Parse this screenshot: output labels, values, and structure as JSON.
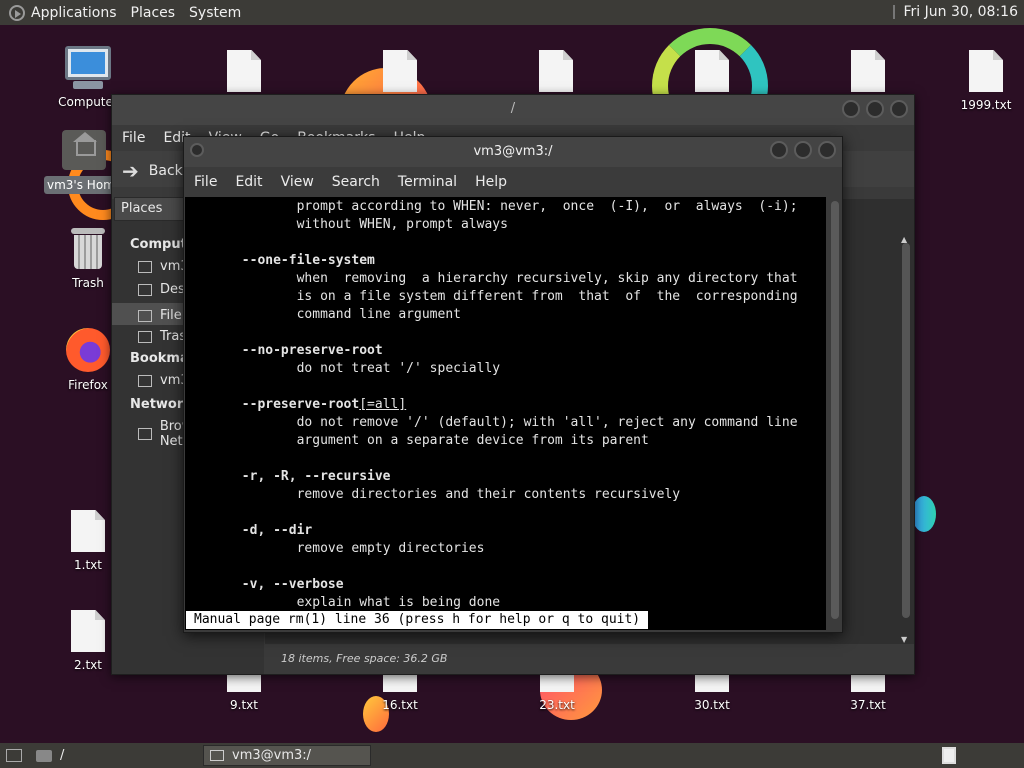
{
  "top_panel": {
    "menus": [
      "Applications",
      "Places",
      "System"
    ],
    "clock": "Fri Jun 30, 08:16"
  },
  "desktop": {
    "icons": [
      {
        "label": "Computer",
        "kind": "computer"
      },
      {
        "label": "vm3's Home",
        "kind": "home"
      },
      {
        "label": "Trash",
        "kind": "trash"
      },
      {
        "label": "Firefox",
        "kind": "firefox"
      },
      {
        "label": "1.txt",
        "kind": "doc"
      },
      {
        "label": "2.txt",
        "kind": "doc"
      },
      {
        "label": "9.txt",
        "kind": "doc"
      },
      {
        "label": "16.txt",
        "kind": "doc"
      },
      {
        "label": "23.txt",
        "kind": "doc"
      },
      {
        "label": "30.txt",
        "kind": "doc"
      },
      {
        "label": "37.txt",
        "kind": "doc"
      },
      {
        "label": "1999.txt",
        "kind": "doc"
      }
    ]
  },
  "file_manager": {
    "title": "/",
    "menus": [
      "File",
      "Edit",
      "View",
      "Go",
      "Bookmarks",
      "Help"
    ],
    "back_label": "Back",
    "places_label": "Places",
    "sidebar": {
      "computer_header": "Computer",
      "items_computer": [
        "vm3",
        "Desktop",
        "File System",
        "Trash"
      ],
      "bookmarks_header": "Bookmarks",
      "items_bookmarks": [
        "vm3"
      ],
      "network_header": "Network",
      "items_network": [
        "Browse Network"
      ]
    },
    "status": "18 items, Free space: 36.2 GB"
  },
  "terminal": {
    "title": "vm3@vm3:/",
    "menus": [
      "File",
      "Edit",
      "View",
      "Search",
      "Terminal",
      "Help"
    ],
    "lines": [
      {
        "indent": 14,
        "text": "prompt according to WHEN: never,  once  (-I),  or  always  (-i);"
      },
      {
        "indent": 14,
        "text": "without WHEN, prompt always"
      },
      {
        "indent": 0,
        "text": ""
      },
      {
        "indent": 7,
        "text": "--one-file-system",
        "bold": true
      },
      {
        "indent": 14,
        "text": "when  removing  a hierarchy recursively, skip any directory that"
      },
      {
        "indent": 14,
        "text": "is on a file system different from  that  of  the  corresponding"
      },
      {
        "indent": 14,
        "text": "command line argument"
      },
      {
        "indent": 0,
        "text": ""
      },
      {
        "indent": 7,
        "text": "--no-preserve-root",
        "bold": true
      },
      {
        "indent": 14,
        "text": "do not treat '/' specially"
      },
      {
        "indent": 0,
        "text": ""
      },
      {
        "indent": 7,
        "text": "--preserve-root",
        "bold": true,
        "suffix": "[=all]"
      },
      {
        "indent": 14,
        "text": "do not remove '/' (default); with 'all', reject any command line"
      },
      {
        "indent": 14,
        "text": "argument on a separate device from its parent"
      },
      {
        "indent": 0,
        "text": ""
      },
      {
        "indent": 7,
        "text": "-r, -R, --recursive",
        "bold": true
      },
      {
        "indent": 14,
        "text": "remove directories and their contents recursively"
      },
      {
        "indent": 0,
        "text": ""
      },
      {
        "indent": 7,
        "text": "-d, --dir",
        "bold": true
      },
      {
        "indent": 14,
        "text": "remove empty directories"
      },
      {
        "indent": 0,
        "text": ""
      },
      {
        "indent": 7,
        "text": "-v, --verbose",
        "bold": true
      },
      {
        "indent": 14,
        "text": "explain what is being done"
      }
    ],
    "status_line": "Manual page rm(1) line 36 (press h for help or q to quit)"
  },
  "bottom_panel": {
    "path": "/",
    "task": "vm3@vm3:/"
  }
}
